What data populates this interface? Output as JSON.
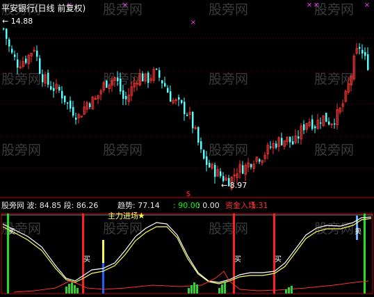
{
  "app": {
    "title": "平安银行(日线 前复权)"
  },
  "colors": {
    "background": "#000000",
    "up": "#ff3232",
    "down": "#54ffff",
    "title": "#ffffff",
    "magenta_marker": "#ff44ff",
    "grid": "#c00000",
    "white_line": "#ffffff",
    "yellow_line": "#ffff60",
    "red_line": "#ff3030",
    "buy_bar": "#ff2020",
    "sell_bar": "#20e020",
    "green_hist": "#30d030",
    "label_text": "#e8e8e8",
    "ind_yellow": "#ffff00",
    "ind_green": "#00ff00",
    "ind_white": "#ffffff",
    "ind_red": "#ff3030",
    "panel_border": "#c00000"
  },
  "watermark": "股旁网",
  "price_panel": {
    "high_label": "14.88",
    "low_label": "8.97",
    "dollar_marker": "$",
    "arrow_high": "←",
    "arrow_low": "←"
  },
  "indicator_bar": {
    "segments": [
      {
        "text": "股旁网 波: 84.85 段: 86.26",
        "color": "#e8e8e8"
      },
      {
        "text": "趋势: 77.14",
        "color": "#e8e8e8"
      },
      {
        "text": ": 90.00",
        "color": "#00ff00"
      },
      {
        "text": ": 0.00",
        "color": "#e8e8e8"
      },
      {
        "text": "资金入场: ",
        "color": "#ff3030"
      },
      {
        "text": "1.31",
        "color": "#ff3030"
      }
    ]
  },
  "indicator_panel": {
    "main_force_label": "主力进场",
    "star": "★",
    "buy_label": "买",
    "sell_label": "卖"
  },
  "chart_data": {
    "type": "candlestick",
    "title": "平安银行(日线 前复权)",
    "price_high": 14.88,
    "price_low": 8.97,
    "indicators": {
      "wave": 84.85,
      "segment": 86.26,
      "trend": 77.14,
      "level_90": 90.0,
      "zero": 0.0,
      "fund_entry": 1.31
    },
    "labels": [
      "主力进场",
      "买",
      "卖"
    ]
  }
}
